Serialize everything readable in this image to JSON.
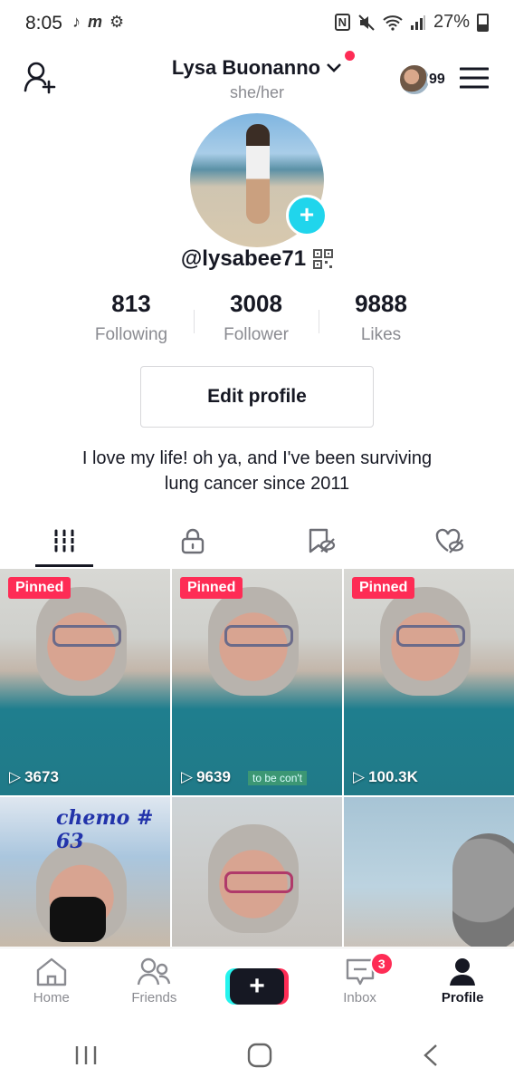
{
  "status_bar": {
    "time": "8:05",
    "left_icons": [
      "tiktok-icon",
      "m-icon",
      "gear-icon"
    ],
    "right_icons": [
      "nfc-icon",
      "mute-icon",
      "wifi-icon",
      "signal-icon"
    ],
    "battery": "27%"
  },
  "header": {
    "display_name": "Lysa Buonanno",
    "pronouns": "she/her",
    "friends_count": "99"
  },
  "profile": {
    "handle": "@lysabee71",
    "stats": [
      {
        "value": "813",
        "label": "Following"
      },
      {
        "value": "3008",
        "label": "Follower"
      },
      {
        "value": "9888",
        "label": "Likes"
      }
    ],
    "edit_button": "Edit profile",
    "bio_line1": "I love my life! oh ya, and I've been surviving",
    "bio_line2": "lung cancer since 2011"
  },
  "tabs": [
    {
      "icon": "grid-icon",
      "active": true
    },
    {
      "icon": "lock-icon",
      "active": false
    },
    {
      "icon": "bookmark-hidden-icon",
      "active": false
    },
    {
      "icon": "heart-hidden-icon",
      "active": false
    }
  ],
  "videos": [
    {
      "pinned": "Pinned",
      "views": "3673"
    },
    {
      "pinned": "Pinned",
      "views": "9639",
      "caption": "to be con't"
    },
    {
      "pinned": "Pinned",
      "views": "100.3K"
    },
    {
      "overlay_text": "chemo # 63"
    },
    {},
    {}
  ],
  "bottom_nav": {
    "home": "Home",
    "friends": "Friends",
    "inbox": "Inbox",
    "inbox_badge": "3",
    "profile": "Profile"
  },
  "colors": {
    "accent_red": "#fe2c55",
    "accent_cyan": "#25f4ee",
    "text_primary": "#161823",
    "text_secondary": "#8a8b91"
  }
}
